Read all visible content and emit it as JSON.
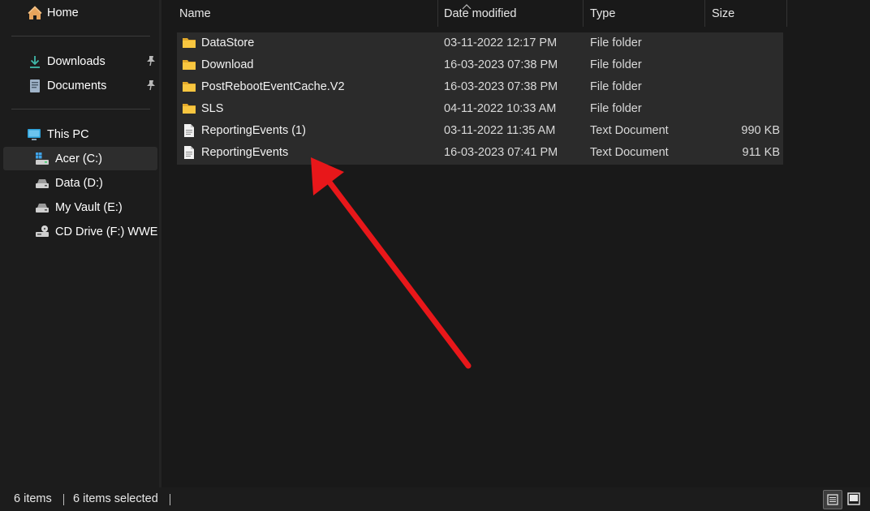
{
  "sidebar": {
    "items": [
      {
        "label": "Home",
        "icon": "home-icon"
      },
      {
        "label": "Downloads",
        "icon": "download-icon",
        "pinned": true
      },
      {
        "label": "Documents",
        "icon": "documents-icon",
        "pinned": true
      },
      {
        "label": "This PC",
        "icon": "monitor-icon"
      },
      {
        "label": "Acer (C:)",
        "icon": "windows-drive-icon",
        "selected": true
      },
      {
        "label": "Data (D:)",
        "icon": "drive-icon"
      },
      {
        "label": "My Vault (E:)",
        "icon": "drive-icon"
      },
      {
        "label": "CD Drive (F:) WWE",
        "icon": "cd-drive-icon"
      }
    ]
  },
  "columns": {
    "name": "Name",
    "date": "Date modified",
    "type": "Type",
    "size": "Size"
  },
  "files": [
    {
      "name": "DataStore",
      "date": "03-11-2022 12:17 PM",
      "type": "File folder",
      "size": "",
      "icon": "folder-icon"
    },
    {
      "name": "Download",
      "date": "16-03-2023 07:38 PM",
      "type": "File folder",
      "size": "",
      "icon": "folder-icon"
    },
    {
      "name": "PostRebootEventCache.V2",
      "date": "16-03-2023 07:38 PM",
      "type": "File folder",
      "size": "",
      "icon": "folder-icon"
    },
    {
      "name": "SLS",
      "date": "04-11-2022 10:33 AM",
      "type": "File folder",
      "size": "",
      "icon": "folder-icon"
    },
    {
      "name": "ReportingEvents (1)",
      "date": "03-11-2022 11:35 AM",
      "type": "Text Document",
      "size": "990 KB",
      "icon": "text-file-icon"
    },
    {
      "name": "ReportingEvents",
      "date": "16-03-2023 07:41 PM",
      "type": "Text Document",
      "size": "911 KB",
      "icon": "text-file-icon"
    }
  ],
  "status": {
    "item_count": "6 items",
    "selected_count": "6 items selected"
  },
  "colors": {
    "background": "#191919",
    "selection": "#2b2b2b",
    "folder": "#f8c640",
    "annotation_arrow": "#e8171a"
  }
}
